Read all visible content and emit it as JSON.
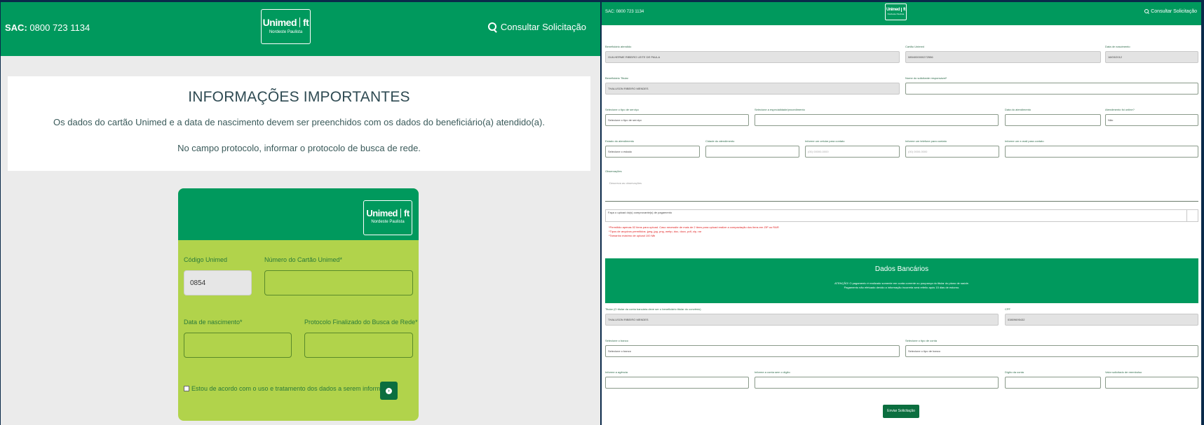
{
  "left": {
    "header": {
      "sac_label": "SAC:",
      "sac_phone": "0800 723 1134",
      "logo_brand": "Unimed",
      "logo_sub": "Nordeste Paulista",
      "consult_label": "Consultar Solicitação"
    },
    "info": {
      "title": "INFORMAÇÕES IMPORTANTES",
      "line1": "Os dados do cartão Unimed e a data de nascimento devem ser preenchidos com os dados do beneficiário(a) atendido(a).",
      "line2": "No campo protocolo, informar o protocolo de busca de rede."
    },
    "card": {
      "logo_brand": "Unimed",
      "logo_sub": "Nordeste Paulista",
      "codigo_label": "Código Unimed",
      "codigo_value": "0854",
      "numero_label": "Número do Cartão Unimed*",
      "nascimento_label": "Data de nascimento*",
      "protocolo_label": "Protocolo Finalizado do Busca de Rede*",
      "consent_label": "Estou de acordo com o uso e tratamento dos dados a serem informados."
    }
  },
  "right": {
    "header": {
      "sac": "SAC: 0800 723 1134",
      "logo_brand": "Unimed",
      "logo_sub": "Nordeste Paulista",
      "consult_label": "Consultar Solicitação"
    },
    "form": {
      "benef_atendido_label": "Beneficiário atendido",
      "benef_atendido_value": "GUILHERME RIBEIRO LEITE DE PAULA",
      "cartao_label": "Cartão Unimed",
      "cartao_value": "0854000000272556",
      "nasc_label": "Data de nascimento",
      "nasc_value": "18/03/2012",
      "benef_titular_label": "Beneficiário Titular",
      "benef_titular_value": "THALUSON RIBEIRO MENDES",
      "solicitante_label": "Nome do solicitante responsável*",
      "tipo_servico_label": "Selecione o tipo de serviço",
      "tipo_servico_value": "Selecione o tipo de serviço",
      "especialidade_label": "Selecione a especialidade/procedimento",
      "data_atend_label": "Data do atendimento",
      "online_label": "Atendimento foi online?",
      "online_value": "Não",
      "estado_label": "Estado do atendimento",
      "estado_value": "Selecione o estado",
      "cidade_label": "Cidade do atendimento",
      "celular_label": "Informe um celular para contato",
      "celular_ph": "(00) 00000-0000",
      "telefone_label": "Informe um telefone para contato",
      "telefone_ph": "(00) 0000-0000",
      "email_label": "Informe um e-mail para contato",
      "obs_label": "Observações",
      "obs_ph": "Descreva as observações",
      "upload_label": "Faça o upload do(s) comprovante(s) de pagamento",
      "note1": "*Permitido apenas 02 itens para upload. Caso necessite de mais de 2 itens para upload realize a compactação dos itens em ZIP ou RAR",
      "note2": "*Tipos de arquivos permitidos: jpeg, jpg, png, webp, doc, docx, pdf, zip, rar",
      "note3": "*Tamanho máximo de upload 100 Mb"
    },
    "bank": {
      "title": "Dados Bancários",
      "attention": "ATENÇÃO! O pagamento é realizado somente em conta corrente ou poupança do titular do plano de saúde.",
      "attention2": "Pagamento não efetuado devido a informação incorreta será refeito após 15 dias de estorno.",
      "titular_label": "Titular (O titular da conta bancária deve ser o beneficiário titular do convênio)",
      "titular_value": "THALUSON RIBEIRO MENDES",
      "cpf_label": "CPF",
      "cpf_value": "03809695432",
      "banco_label": "Selecione o banco",
      "banco_value": "Selecione o banco",
      "tipo_conta_label": "Selecione o tipo de conta",
      "tipo_conta_value": "Selecione o tipo de banco",
      "agencia_label": "Informe a agência",
      "conta_label": "Informe a conta sem o dígito",
      "digito_label": "Dígito da conta",
      "valor_label": "Valor solicitado de reembolso",
      "send_label": "Enviar Solicitação"
    }
  },
  "colors": {
    "primary_green": "#00995d",
    "lime": "#b1d34b",
    "dark_green": "#0b6e3f",
    "error": "#e02020"
  }
}
